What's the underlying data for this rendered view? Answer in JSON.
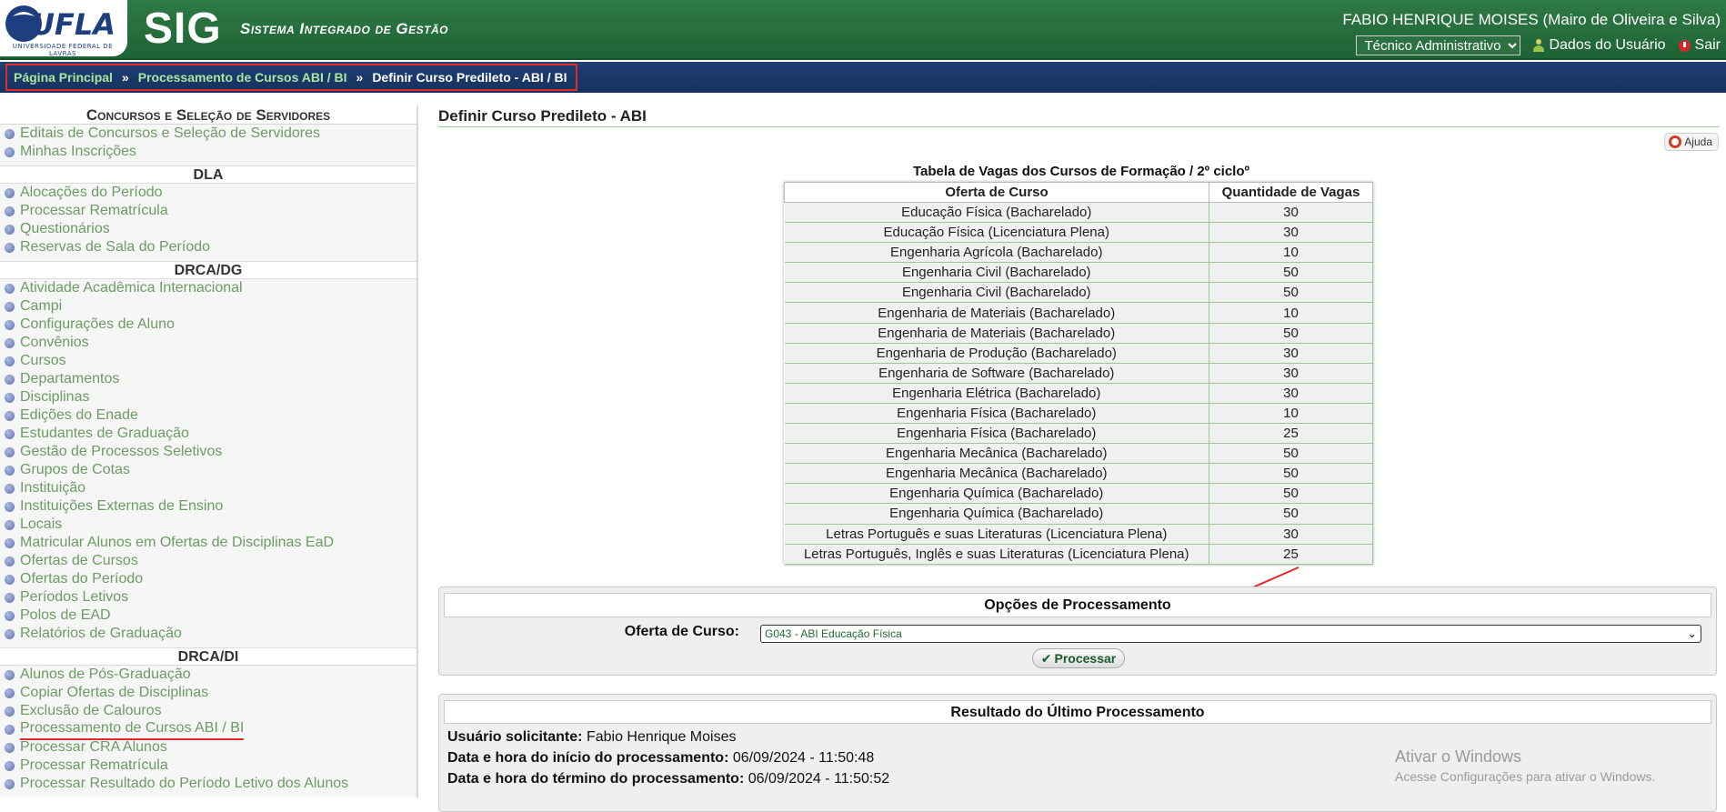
{
  "header": {
    "logo_text": "UFLA",
    "logo_subtitle": "UNIVERSIDADE FEDERAL DE LAVRAS",
    "app_name": "SIG",
    "app_subtitle": "Sistema Integrado de Gestão",
    "user_name": "FABIO HENRIQUE MOISES (Mairo de Oliveira e Silva)",
    "role_selected": "Técnico Administrativo",
    "user_data_label": "Dados do Usuário",
    "logout_label": "Sair"
  },
  "breadcrumb": {
    "items": [
      "Página Principal",
      "Processamento de Cursos ABI / BI",
      "Definir Curso Predileto - ABI / BI"
    ],
    "separator": "»"
  },
  "sidebar": {
    "title": "Concursos e Seleção de Servidores",
    "groups": [
      {
        "heading": "",
        "items": [
          "Editais de Concursos e Seleção de Servidores",
          "Minhas Inscrições"
        ]
      },
      {
        "heading": "DLA",
        "items": [
          "Alocações do Período",
          "Processar Rematrícula",
          "Questionários",
          "Reservas de Sala do Período"
        ]
      },
      {
        "heading": "DRCA/DG",
        "items": [
          "Atividade Acadêmica Internacional",
          "Campi",
          "Configurações de Aluno",
          "Convênios",
          "Cursos",
          "Departamentos",
          "Disciplinas",
          "Edições do Enade",
          "Estudantes de Graduação",
          "Gestão de Processos Seletivos",
          "Grupos de Cotas",
          "Instituição",
          "Instituições Externas de Ensino",
          "Locais",
          "Matricular Alunos em Ofertas de Disciplinas EaD",
          "Ofertas de Cursos",
          "Ofertas do Período",
          "Períodos Letivos",
          "Polos de EAD",
          "Relatórios de Graduação"
        ]
      },
      {
        "heading": "DRCA/DI",
        "items": [
          "Alunos de Pós-Graduação",
          "Copiar Ofertas de Disciplinas",
          "Exclusão de Calouros",
          "Processamento de Cursos ABI / BI",
          "Processar CRA Alunos",
          "Processar Rematrícula",
          "Processar Resultado do Período Letivo dos Alunos"
        ]
      }
    ],
    "highlighted_item": "Processamento de Cursos ABI / BI"
  },
  "main": {
    "page_title": "Definir Curso Predileto - ABI",
    "help_label": "Ajuda",
    "vagas_table": {
      "caption": "Tabela de Vagas dos Cursos de Formação / 2º cicloº",
      "headers": [
        "Oferta de Curso",
        "Quantidade de Vagas"
      ],
      "rows": [
        [
          "Educação Física (Bacharelado)",
          "30"
        ],
        [
          "Educação Física (Licenciatura Plena)",
          "30"
        ],
        [
          "Engenharia Agrícola (Bacharelado)",
          "10"
        ],
        [
          "Engenharia Civil (Bacharelado)",
          "50"
        ],
        [
          "Engenharia Civil (Bacharelado)",
          "50"
        ],
        [
          "Engenharia de Materiais (Bacharelado)",
          "10"
        ],
        [
          "Engenharia de Materiais (Bacharelado)",
          "50"
        ],
        [
          "Engenharia de Produção (Bacharelado)",
          "30"
        ],
        [
          "Engenharia de Software (Bacharelado)",
          "30"
        ],
        [
          "Engenharia Elétrica (Bacharelado)",
          "30"
        ],
        [
          "Engenharia Física (Bacharelado)",
          "10"
        ],
        [
          "Engenharia Física (Bacharelado)",
          "25"
        ],
        [
          "Engenharia Mecânica (Bacharelado)",
          "50"
        ],
        [
          "Engenharia Mecânica (Bacharelado)",
          "50"
        ],
        [
          "Engenharia Química (Bacharelado)",
          "50"
        ],
        [
          "Engenharia Química (Bacharelado)",
          "50"
        ],
        [
          "Letras Português e suas Literaturas (Licenciatura Plena)",
          "30"
        ],
        [
          "Letras Português, Inglês e suas Literaturas (Licenciatura Plena)",
          "25"
        ]
      ]
    },
    "options": {
      "title": "Opções de Processamento",
      "course_label": "Oferta de Curso:",
      "course_selected": "G043 - ABI Educação Física",
      "process_label": "Processar"
    },
    "result": {
      "title": "Resultado do Último Processamento",
      "requester_label": "Usuário solicitante:",
      "requester_value": "Fabio Henrique Moises",
      "start_label": "Data e hora do início do processamento:",
      "start_value": "06/09/2024 - 11:50:48",
      "end_label": "Data e hora do término do processamento:",
      "end_value": "06/09/2024 - 11:50:52"
    }
  },
  "watermark": {
    "line1": "Ativar o Windows",
    "line2": "Acesse Configurações para ativar o Windows."
  },
  "colors": {
    "header_green": "#1e6336",
    "breadcrumb_navy": "#1f3f73",
    "link_green": "#6b9d63",
    "annotation_red": "#e12b2b"
  }
}
